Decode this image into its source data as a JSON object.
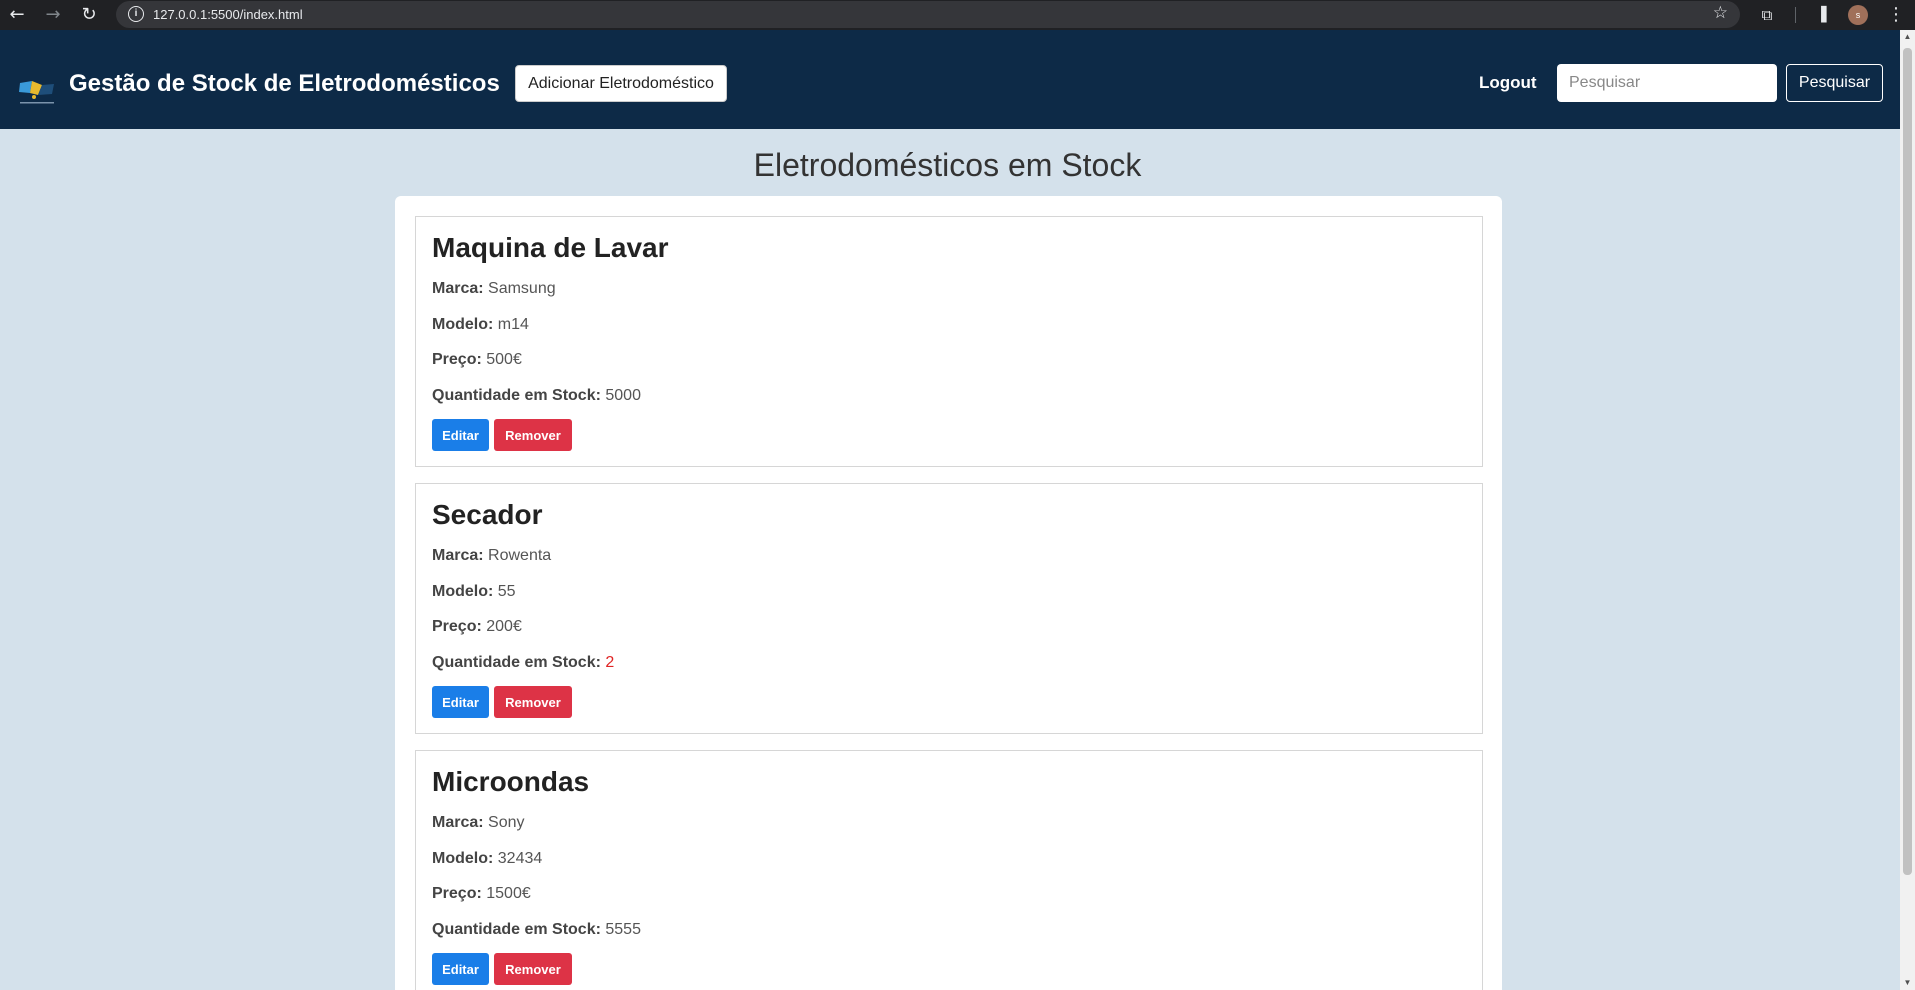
{
  "browser": {
    "url": "127.0.0.1:5500/index.html",
    "profile_initial": "s"
  },
  "header": {
    "title": "Gestão de Stock de Eletrodomésticos",
    "add_label": "Adicionar Eletrodoméstico",
    "logout_label": "Logout",
    "search_placeholder": "Pesquisar",
    "search_button": "Pesquisar"
  },
  "main": {
    "title": "Eletrodomésticos em Stock",
    "labels": {
      "brand": "Marca:",
      "model": "Modelo:",
      "price": "Preço:",
      "stock": "Quantidade em Stock:",
      "edit": "Editar",
      "remove": "Remover"
    },
    "items": [
      {
        "name": "Maquina de Lavar",
        "brand": "Samsung",
        "model": "m14",
        "price": "500€",
        "stock": "5000",
        "low_stock": false
      },
      {
        "name": "Secador",
        "brand": "Rowenta",
        "model": "55",
        "price": "200€",
        "stock": "2",
        "low_stock": true
      },
      {
        "name": "Microondas",
        "brand": "Sony",
        "model": "32434",
        "price": "1500€",
        "stock": "5555",
        "low_stock": false
      }
    ]
  },
  "colors": {
    "header_bg": "#0d2a47",
    "page_bg": "#d4e1eb",
    "edit_button": "#1a7ee8",
    "remove_button": "#dd3346",
    "low_stock": "#e02424"
  }
}
